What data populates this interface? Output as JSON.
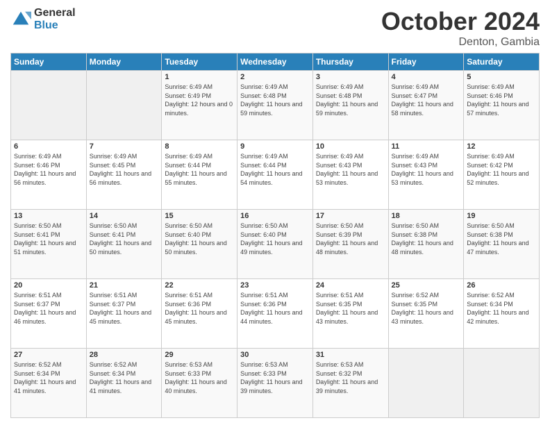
{
  "logo": {
    "general": "General",
    "blue": "Blue"
  },
  "header": {
    "month": "October 2024",
    "location": "Denton, Gambia"
  },
  "weekdays": [
    "Sunday",
    "Monday",
    "Tuesday",
    "Wednesday",
    "Thursday",
    "Friday",
    "Saturday"
  ],
  "weeks": [
    [
      {
        "day": "",
        "sunrise": "",
        "sunset": "",
        "daylight": ""
      },
      {
        "day": "",
        "sunrise": "",
        "sunset": "",
        "daylight": ""
      },
      {
        "day": "1",
        "sunrise": "Sunrise: 6:49 AM",
        "sunset": "Sunset: 6:49 PM",
        "daylight": "Daylight: 12 hours and 0 minutes."
      },
      {
        "day": "2",
        "sunrise": "Sunrise: 6:49 AM",
        "sunset": "Sunset: 6:48 PM",
        "daylight": "Daylight: 11 hours and 59 minutes."
      },
      {
        "day": "3",
        "sunrise": "Sunrise: 6:49 AM",
        "sunset": "Sunset: 6:48 PM",
        "daylight": "Daylight: 11 hours and 59 minutes."
      },
      {
        "day": "4",
        "sunrise": "Sunrise: 6:49 AM",
        "sunset": "Sunset: 6:47 PM",
        "daylight": "Daylight: 11 hours and 58 minutes."
      },
      {
        "day": "5",
        "sunrise": "Sunrise: 6:49 AM",
        "sunset": "Sunset: 6:46 PM",
        "daylight": "Daylight: 11 hours and 57 minutes."
      }
    ],
    [
      {
        "day": "6",
        "sunrise": "Sunrise: 6:49 AM",
        "sunset": "Sunset: 6:46 PM",
        "daylight": "Daylight: 11 hours and 56 minutes."
      },
      {
        "day": "7",
        "sunrise": "Sunrise: 6:49 AM",
        "sunset": "Sunset: 6:45 PM",
        "daylight": "Daylight: 11 hours and 56 minutes."
      },
      {
        "day": "8",
        "sunrise": "Sunrise: 6:49 AM",
        "sunset": "Sunset: 6:44 PM",
        "daylight": "Daylight: 11 hours and 55 minutes."
      },
      {
        "day": "9",
        "sunrise": "Sunrise: 6:49 AM",
        "sunset": "Sunset: 6:44 PM",
        "daylight": "Daylight: 11 hours and 54 minutes."
      },
      {
        "day": "10",
        "sunrise": "Sunrise: 6:49 AM",
        "sunset": "Sunset: 6:43 PM",
        "daylight": "Daylight: 11 hours and 53 minutes."
      },
      {
        "day": "11",
        "sunrise": "Sunrise: 6:49 AM",
        "sunset": "Sunset: 6:43 PM",
        "daylight": "Daylight: 11 hours and 53 minutes."
      },
      {
        "day": "12",
        "sunrise": "Sunrise: 6:49 AM",
        "sunset": "Sunset: 6:42 PM",
        "daylight": "Daylight: 11 hours and 52 minutes."
      }
    ],
    [
      {
        "day": "13",
        "sunrise": "Sunrise: 6:50 AM",
        "sunset": "Sunset: 6:41 PM",
        "daylight": "Daylight: 11 hours and 51 minutes."
      },
      {
        "day": "14",
        "sunrise": "Sunrise: 6:50 AM",
        "sunset": "Sunset: 6:41 PM",
        "daylight": "Daylight: 11 hours and 50 minutes."
      },
      {
        "day": "15",
        "sunrise": "Sunrise: 6:50 AM",
        "sunset": "Sunset: 6:40 PM",
        "daylight": "Daylight: 11 hours and 50 minutes."
      },
      {
        "day": "16",
        "sunrise": "Sunrise: 6:50 AM",
        "sunset": "Sunset: 6:40 PM",
        "daylight": "Daylight: 11 hours and 49 minutes."
      },
      {
        "day": "17",
        "sunrise": "Sunrise: 6:50 AM",
        "sunset": "Sunset: 6:39 PM",
        "daylight": "Daylight: 11 hours and 48 minutes."
      },
      {
        "day": "18",
        "sunrise": "Sunrise: 6:50 AM",
        "sunset": "Sunset: 6:38 PM",
        "daylight": "Daylight: 11 hours and 48 minutes."
      },
      {
        "day": "19",
        "sunrise": "Sunrise: 6:50 AM",
        "sunset": "Sunset: 6:38 PM",
        "daylight": "Daylight: 11 hours and 47 minutes."
      }
    ],
    [
      {
        "day": "20",
        "sunrise": "Sunrise: 6:51 AM",
        "sunset": "Sunset: 6:37 PM",
        "daylight": "Daylight: 11 hours and 46 minutes."
      },
      {
        "day": "21",
        "sunrise": "Sunrise: 6:51 AM",
        "sunset": "Sunset: 6:37 PM",
        "daylight": "Daylight: 11 hours and 45 minutes."
      },
      {
        "day": "22",
        "sunrise": "Sunrise: 6:51 AM",
        "sunset": "Sunset: 6:36 PM",
        "daylight": "Daylight: 11 hours and 45 minutes."
      },
      {
        "day": "23",
        "sunrise": "Sunrise: 6:51 AM",
        "sunset": "Sunset: 6:36 PM",
        "daylight": "Daylight: 11 hours and 44 minutes."
      },
      {
        "day": "24",
        "sunrise": "Sunrise: 6:51 AM",
        "sunset": "Sunset: 6:35 PM",
        "daylight": "Daylight: 11 hours and 43 minutes."
      },
      {
        "day": "25",
        "sunrise": "Sunrise: 6:52 AM",
        "sunset": "Sunset: 6:35 PM",
        "daylight": "Daylight: 11 hours and 43 minutes."
      },
      {
        "day": "26",
        "sunrise": "Sunrise: 6:52 AM",
        "sunset": "Sunset: 6:34 PM",
        "daylight": "Daylight: 11 hours and 42 minutes."
      }
    ],
    [
      {
        "day": "27",
        "sunrise": "Sunrise: 6:52 AM",
        "sunset": "Sunset: 6:34 PM",
        "daylight": "Daylight: 11 hours and 41 minutes."
      },
      {
        "day": "28",
        "sunrise": "Sunrise: 6:52 AM",
        "sunset": "Sunset: 6:34 PM",
        "daylight": "Daylight: 11 hours and 41 minutes."
      },
      {
        "day": "29",
        "sunrise": "Sunrise: 6:53 AM",
        "sunset": "Sunset: 6:33 PM",
        "daylight": "Daylight: 11 hours and 40 minutes."
      },
      {
        "day": "30",
        "sunrise": "Sunrise: 6:53 AM",
        "sunset": "Sunset: 6:33 PM",
        "daylight": "Daylight: 11 hours and 39 minutes."
      },
      {
        "day": "31",
        "sunrise": "Sunrise: 6:53 AM",
        "sunset": "Sunset: 6:32 PM",
        "daylight": "Daylight: 11 hours and 39 minutes."
      },
      {
        "day": "",
        "sunrise": "",
        "sunset": "",
        "daylight": ""
      },
      {
        "day": "",
        "sunrise": "",
        "sunset": "",
        "daylight": ""
      }
    ]
  ]
}
